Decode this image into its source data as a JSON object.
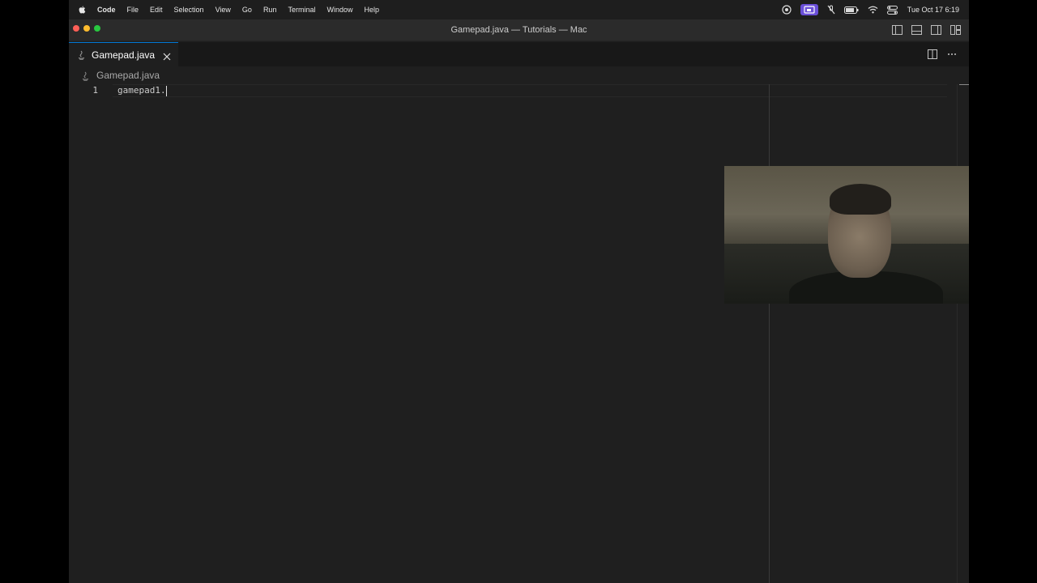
{
  "menubar": {
    "items": [
      "Code",
      "File",
      "Edit",
      "Selection",
      "View",
      "Go",
      "Run",
      "Terminal",
      "Window",
      "Help"
    ],
    "clock": "Tue Oct 17  6:19",
    "status_icons": [
      "creative-cloud-icon",
      "screen-share-icon",
      "mic-off-icon",
      "battery-icon",
      "wifi-icon",
      "control-center-icon"
    ]
  },
  "window": {
    "title": "Gamepad.java — Tutorials — Mac"
  },
  "tab": {
    "label": "Gamepad.java",
    "icon": "java-icon"
  },
  "breadcrumb": {
    "file": "Gamepad.java"
  },
  "editor": {
    "lines": [
      {
        "number": "1",
        "text": "gamepad1."
      }
    ]
  },
  "colors": {
    "accent": "#0078d4",
    "editor_bg": "#1f1f1f",
    "tab_bar_bg": "#181818",
    "title_bar_bg": "#2b2b2b",
    "screen_share_active": "#6a4fd8"
  },
  "webcam": {
    "description_icon": "webcam-overlay"
  }
}
